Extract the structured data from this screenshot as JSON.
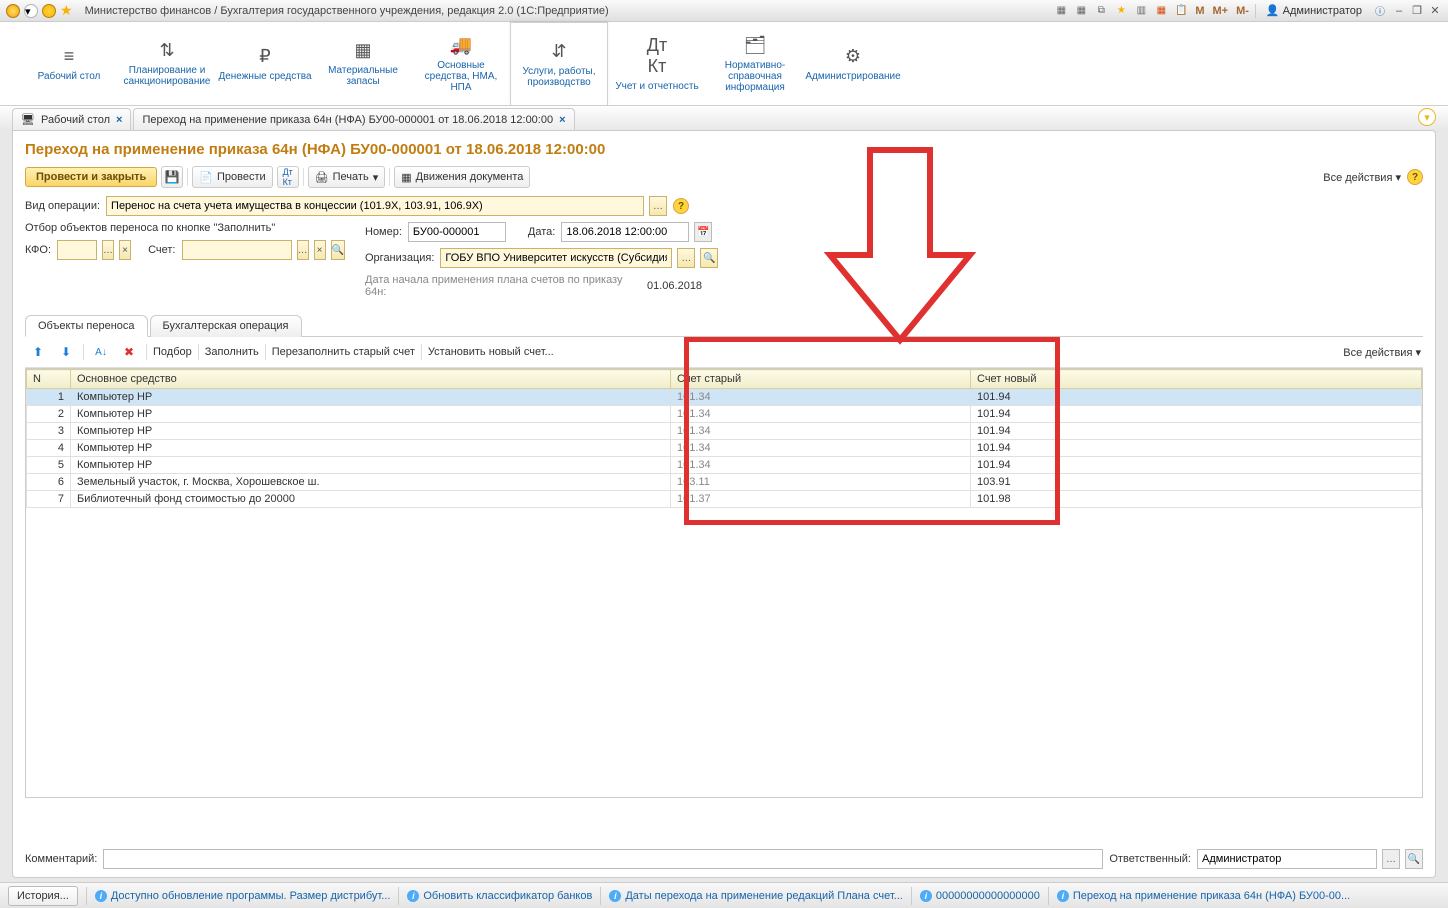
{
  "titlebar": {
    "title": "Министерство финансов / Бухгалтерия государственного учреждения, редакция 2.0  (1С:Предприятие)",
    "user": "Администратор",
    "m": "M",
    "mplus": "M+",
    "mminus": "M-"
  },
  "sections": [
    {
      "label": "Рабочий стол"
    },
    {
      "label": "Планирование и санкционирование"
    },
    {
      "label": "Денежные средства"
    },
    {
      "label": "Материальные запасы"
    },
    {
      "label": "Основные средства, НМА, НПА"
    },
    {
      "label": "Услуги, работы, производство"
    },
    {
      "label": "Учет и отчетность"
    },
    {
      "label": "Нормативно-справочная информация"
    },
    {
      "label": "Администрирование"
    }
  ],
  "tabs": [
    {
      "label": "Рабочий стол"
    },
    {
      "label": "Переход на применение приказа 64н (НФА) БУ00-000001 от 18.06.2018 12:00:00"
    }
  ],
  "form": {
    "title": "Переход на применение приказа 64н (НФА) БУ00-000001 от 18.06.2018 12:00:00",
    "cmd": {
      "post_close": "Провести и закрыть",
      "post": "Провести",
      "print": "Печать",
      "movements": "Движения документа",
      "all_actions": "Все действия"
    },
    "fields": {
      "operation_label": "Вид операции:",
      "operation_value": "Перенос на счета учета имущества в концессии (101.9X, 103.91, 106.9X)",
      "filter_caption": "Отбор объектов переноса по кнопке \"Заполнить\"",
      "kfo_label": "КФО:",
      "kfo_value": "",
      "account_label": "Счет:",
      "account_value": "",
      "number_label": "Номер:",
      "number_value": "БУ00-000001",
      "date_label": "Дата:",
      "date_value": "18.06.2018 12:00:00",
      "org_label": "Организация:",
      "org_value": "ГОБУ ВПО Университет искусств (Субсидия)",
      "plan_label": "Дата начала применения плана счетов по приказу 64н:",
      "plan_value": "01.06.2018"
    },
    "inner_tabs": [
      {
        "label": "Объекты переноса"
      },
      {
        "label": "Бухгалтерская операция"
      }
    ],
    "tblbar": {
      "select": "Подбор",
      "fill": "Заполнить",
      "refill": "Перезаполнить старый счет",
      "setnew": "Установить новый счет...",
      "all_actions": "Все действия"
    },
    "columns": {
      "n": "N",
      "os": "Основное средство",
      "so": "Счет старый",
      "sn": "Счет новый"
    },
    "rows": [
      {
        "n": "1",
        "os": "Компьютер HP",
        "so": "101.34",
        "sn": "101.94"
      },
      {
        "n": "2",
        "os": "Компьютер HP",
        "so": "101.34",
        "sn": "101.94"
      },
      {
        "n": "3",
        "os": "Компьютер HP",
        "so": "101.34",
        "sn": "101.94"
      },
      {
        "n": "4",
        "os": "Компьютер HP",
        "so": "101.34",
        "sn": "101.94"
      },
      {
        "n": "5",
        "os": "Компьютер HP",
        "so": "101.34",
        "sn": "101.94"
      },
      {
        "n": "6",
        "os": "Земельный участок, г. Москва, Хорошевское ш.",
        "so": "103.11",
        "sn": "103.91"
      },
      {
        "n": "7",
        "os": "Библиотечный фонд стоимостью до 20000",
        "so": "101.37",
        "sn": "101.98"
      }
    ],
    "footer": {
      "comment_label": "Комментарий:",
      "comment_value": "",
      "responsible_label": "Ответственный:",
      "responsible_value": "Администратор"
    }
  },
  "statusbar": {
    "history": "История...",
    "items": [
      "Доступно обновление программы. Размер дистрибут...",
      "Обновить классификатор банков",
      "Даты перехода на применение редакций Плана счет...",
      "00000000000000000",
      "Переход на применение приказа 64н (НФА) БУ00-00..."
    ]
  }
}
